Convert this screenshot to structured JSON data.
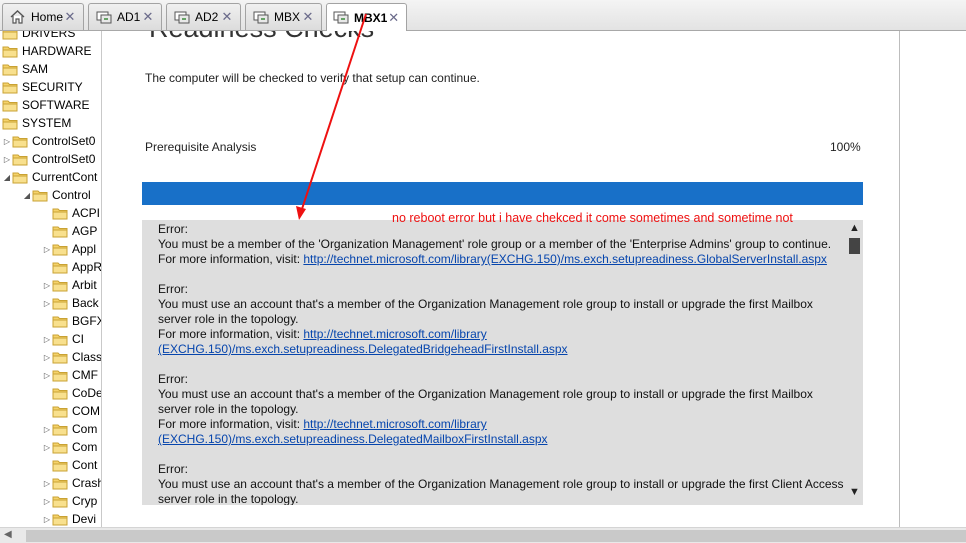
{
  "tabs": [
    {
      "label": "Home",
      "icon": "home-icon"
    },
    {
      "label": "AD1",
      "icon": "remote-desktop-icon"
    },
    {
      "label": "AD2",
      "icon": "remote-desktop-icon"
    },
    {
      "label": "MBX",
      "icon": "remote-desktop-icon"
    },
    {
      "label": "MBX1",
      "icon": "remote-desktop-icon",
      "active": true
    }
  ],
  "tree": {
    "items": [
      {
        "label": "DRIVERS"
      },
      {
        "label": "HARDWARE"
      },
      {
        "label": "SAM"
      },
      {
        "label": "SECURITY"
      },
      {
        "label": "SOFTWARE"
      },
      {
        "label": "SYSTEM"
      },
      {
        "label": "ControlSet0"
      },
      {
        "label": "ControlSet0"
      },
      {
        "label": "CurrentCont"
      },
      {
        "label": "Control"
      },
      {
        "label": "ACPI"
      },
      {
        "label": "AGP"
      },
      {
        "label": "Appl"
      },
      {
        "label": "AppR"
      },
      {
        "label": "Arbit"
      },
      {
        "label": "Back"
      },
      {
        "label": "BGFX"
      },
      {
        "label": "CI"
      },
      {
        "label": "Class"
      },
      {
        "label": "CMF"
      },
      {
        "label": "CoDe"
      },
      {
        "label": "COM"
      },
      {
        "label": "Com"
      },
      {
        "label": "Com"
      },
      {
        "label": "Cont"
      },
      {
        "label": "Crash"
      },
      {
        "label": "Cryp"
      },
      {
        "label": "Devi"
      }
    ]
  },
  "main": {
    "heading": "Readiness Checks",
    "intro": "The computer will be checked to verify that setup can continue.",
    "prereq_label": "Prerequisite Analysis",
    "prereq_percent": "100%",
    "progress_fraction": 1.0,
    "annotation": "no reboot error but i have chekced it come sometimes and sometime not",
    "errors": [
      {
        "title": "Error:",
        "message": "You must be a member of the 'Organization Management' role group or a member of the 'Enterprise Admins' group to continue.",
        "more_info": "For more information, visit: ",
        "link": "http://technet.microsoft.com/library(EXCHG.150)/ms.exch.setupreadiness.GlobalServerInstall.aspx"
      },
      {
        "title": "Error:",
        "message": "You must use an account that's a member of the Organization Management role group to install or upgrade the first Mailbox server role in the topology.",
        "more_info": "For more information, visit: ",
        "link": "http://technet.microsoft.com/library (EXCHG.150)/ms.exch.setupreadiness.DelegatedBridgeheadFirstInstall.aspx"
      },
      {
        "title": "Error:",
        "message": "You must use an account that's a member of the Organization Management role group to install or upgrade the first Mailbox server role in the topology.",
        "more_info": "For more information, visit: ",
        "link": "http://technet.microsoft.com/library (EXCHG.150)/ms.exch.setupreadiness.DelegatedMailboxFirstInstall.aspx"
      },
      {
        "title": "Error:",
        "message": "You must use an account that's a member of the Organization Management role group to install or upgrade the first Client Access server role in the topology.",
        "more_info": "",
        "link": ""
      }
    ]
  },
  "colors": {
    "progress": "#1b6dc1",
    "annotation": "#ee1111",
    "link": "#0645ad",
    "error_panel": "#dedede"
  }
}
